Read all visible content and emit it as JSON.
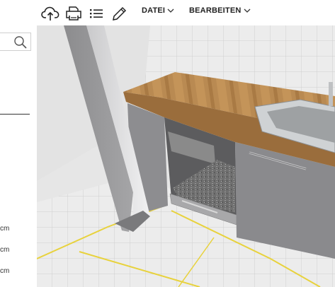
{
  "toolbar": {
    "icons": [
      "cloud-upload-icon",
      "print-icon",
      "list-icon",
      "pencil-icon"
    ],
    "menus": [
      {
        "label": "DATEI"
      },
      {
        "label": "BEARBEITEN"
      }
    ]
  },
  "left_panel": {
    "search_placeholder": "",
    "units": [
      "cm",
      "cm",
      "cm"
    ]
  },
  "viewport": {
    "scene": "kitchen-3d-view"
  },
  "colors": {
    "countertop": "#b9884f",
    "cabinet": "#8a8a8d",
    "pillar": "#9a9a9c",
    "floor_line": "#e8d23c",
    "tile_wall": "#ededed"
  }
}
